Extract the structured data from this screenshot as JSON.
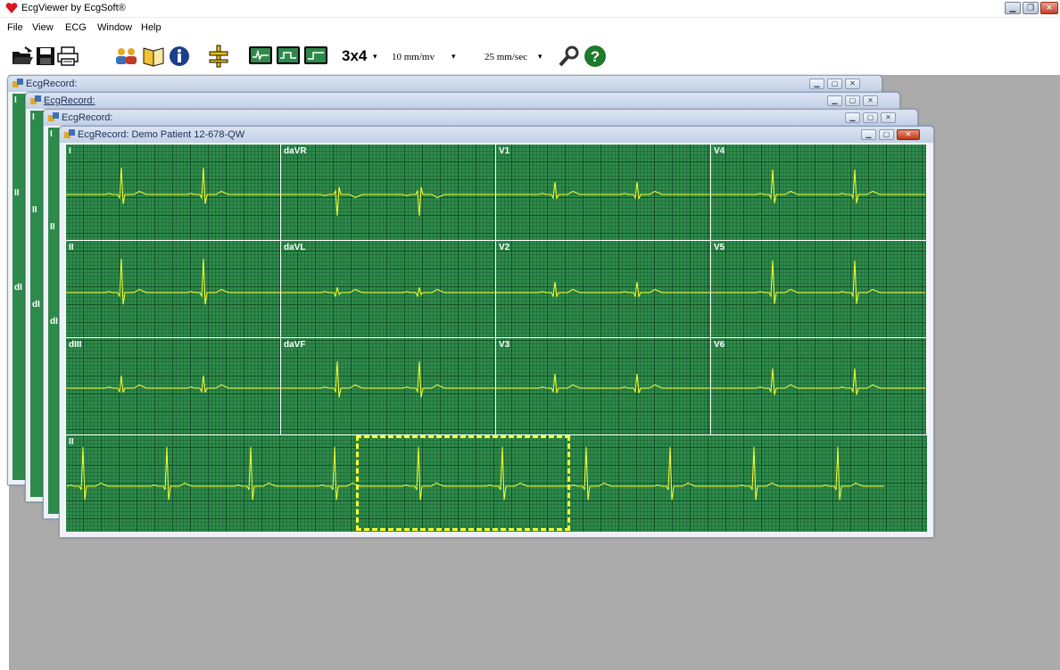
{
  "app": {
    "title": "EcgViewer by EcgSoft®"
  },
  "menu": [
    "File",
    "View",
    "ECG",
    "Window",
    "Help"
  ],
  "toolbar": {
    "layout_label": "3x4",
    "gain_label": "10 mm/mv",
    "speed_label": "25 mm/sec",
    "icons": [
      "open-folder-icon",
      "save-icon",
      "print-icon",
      "patients-icon",
      "book-icon",
      "info-icon",
      "caliper-icon",
      "wave-mode-icon",
      "grid-mode-icon",
      "step-mode-icon",
      "settings-icon",
      "help-icon"
    ]
  },
  "windows": {
    "back1_title": "EcgRecord:",
    "back2_title": "EcgRecord:",
    "back3_title": "EcgRecord:",
    "front_title": "EcgRecord: Demo Patient 12-678-QW"
  },
  "back_leads": {
    "w1": [
      "I",
      "II",
      "dI"
    ],
    "w2": [
      "I",
      "II",
      "dI"
    ],
    "w3": [
      "I",
      "II",
      "dI"
    ]
  },
  "leads": {
    "row1": [
      "I",
      "daVR",
      "V1",
      "V4"
    ],
    "row2": [
      "II",
      "daVL",
      "V2",
      "V5"
    ],
    "row3": [
      "dIII",
      "daVF",
      "V3",
      "V6"
    ],
    "rhythm": "II"
  },
  "colors": {
    "grid": "#2e8a4b",
    "trace": "#ffff33",
    "separator": "#ffffff"
  }
}
